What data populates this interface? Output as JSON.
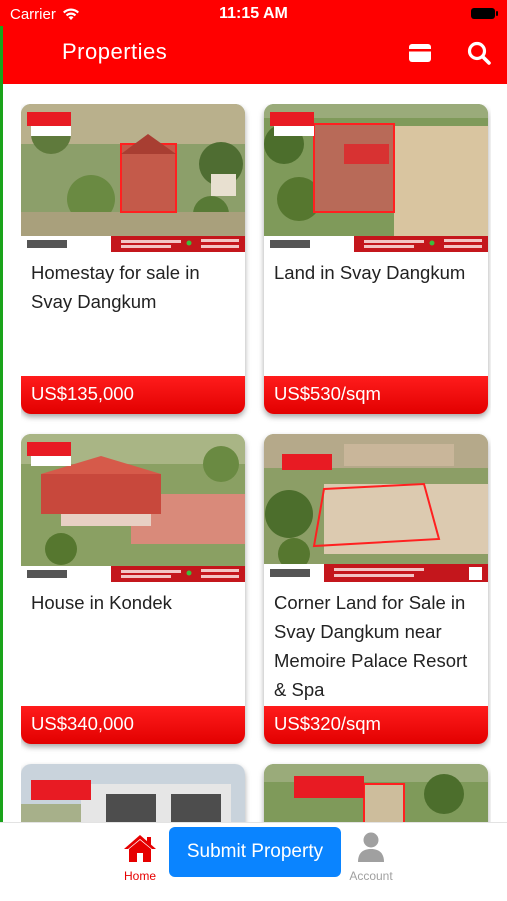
{
  "status_bar": {
    "carrier": "Carrier",
    "time": "11:15 AM"
  },
  "header": {
    "title": "Properties",
    "icons": [
      "card-view-icon",
      "search-icon"
    ]
  },
  "listings": [
    {
      "title": "Homestay for sale in Svay Dangkum",
      "price": "US$135,000"
    },
    {
      "title": "Land in Svay Dangkum",
      "price": "US$530/sqm"
    },
    {
      "title": "House in Kondek",
      "price": "US$340,000"
    },
    {
      "title": "Corner Land for Sale in Svay Dangkum near Memoire Palace Resort & Spa",
      "price": "US$320/sqm"
    }
  ],
  "tab_bar": {
    "home_label": "Home",
    "submit_label": "Submit Property",
    "account_label": "Account"
  },
  "colors": {
    "brand": "#ff0000",
    "submit": "#0a84ff",
    "active_tab": "#e60000",
    "inactive_tab": "#a0a0a0"
  }
}
